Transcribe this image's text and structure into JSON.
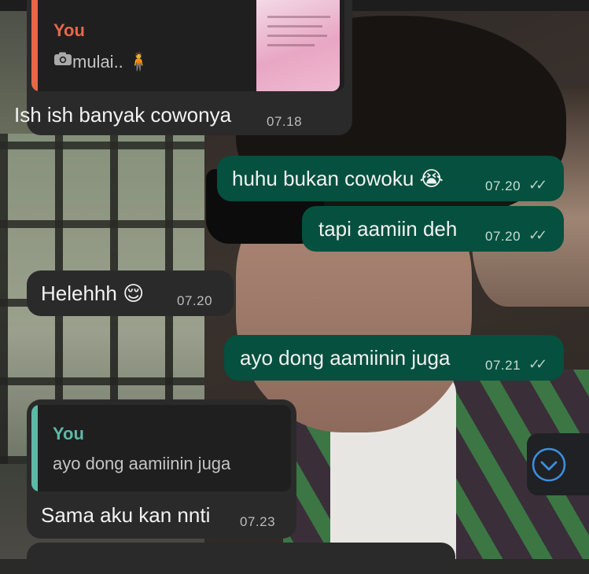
{
  "chat": {
    "reply1": {
      "quote_author": "You",
      "quote_text": "mulai.. 🧍",
      "text": "Ish ish banyak cowonya",
      "time": "07.18"
    },
    "out1": {
      "text": "huhu bukan cowoku 😭",
      "time": "07.20"
    },
    "out2": {
      "text": "tapi aamiin deh",
      "time": "07.20"
    },
    "in1": {
      "text": "Helehhh 😌",
      "time": "07.20"
    },
    "out3": {
      "text": "ayo dong aamiinin juga",
      "time": "07.21"
    },
    "reply2": {
      "quote_author": "You",
      "quote_text": "ayo dong aamiinin juga",
      "text": "Sama aku kan nnti",
      "time": "07.23"
    }
  },
  "icons": {
    "camera": "camera-icon",
    "read_receipt": "double-check-icon",
    "scroll_down": "chevron-down-icon"
  },
  "colors": {
    "incoming_bubble": "#2b2a2b",
    "outgoing_bubble": "#05503f",
    "quote_accent_1": "#e8674a",
    "quote_accent_2": "#5fb8a6",
    "scroll_accent": "#3b8fe0"
  }
}
